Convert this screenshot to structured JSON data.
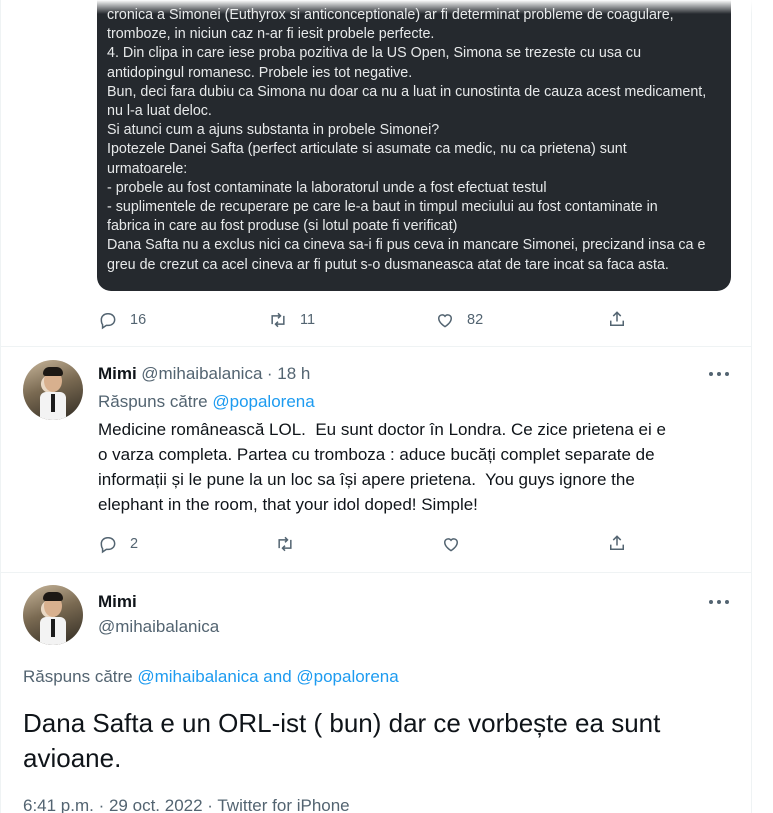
{
  "note_card": {
    "lines": [
      "cronica a Simonei (Euthyrox si anticonceptionale) ar fi determinat probleme de coagulare,",
      "tromboze, in niciun caz n-ar fi iesit probele perfecte.",
      "4. Din clipa in care iese proba pozitiva de la US Open, Simona se trezeste cu usa cu",
      "antidopingul romanesc. Probele ies tot negative.",
      "Bun, deci fara dubiu ca Simona nu doar ca nu a luat in cunostinta de cauza acest medicament,",
      "nu l-a luat deloc.",
      "Si atunci cum a ajuns substanta in probele Simonei?",
      "Ipotezele Danei Safta (perfect articulate si asumate ca medic, nu ca prietena) sunt",
      "urmatoarele:",
      "- probele au fost contaminate la laboratorul unde a fost efectuat testul",
      "- suplimentele de recuperare pe care le-a baut in timpul meciului au fost contaminate in",
      "fabrica in care au fost produse (si lotul poate fi verificat)",
      "Dana Safta nu a exclus nici ca cineva sa-i fi pus ceva in mancare Simonei, precizand insa ca e",
      "greu de crezut ca acel cineva ar fi putut s-o dusmaneasca atat de tare incat sa faca asta."
    ]
  },
  "first_actions": {
    "replies": "16",
    "retweets": "11",
    "likes": "82"
  },
  "reply_tweet": {
    "name": "Mimi",
    "handle": "@mihaibalanica",
    "time": "· 18 h",
    "reply_prefix": "Răspuns către",
    "reply_mention": "@popalorena",
    "text": "Medicine românească LOL.  Eu sunt doctor în Londra. Ce zice prietena ei e\no varza completa. Partea cu tromboza : aduce bucăți complet separate de\ninformații și le pune la un loc sa își apere prietena.  You guys ignore the\nelephant in the room, that your idol doped! Simple!",
    "replies": "2"
  },
  "main_tweet": {
    "name": "Mimi",
    "handle": "@mihaibalanica",
    "reply_prefix": "Răspuns către",
    "reply_mentions": "@mihaibalanica and @popalorena",
    "text": "Dana Safta e un ORL-ist ( bun) dar ce vorbește ea sunt\navioane.",
    "meta": "6:41 p.m. · 29 oct. 2022 · Twitter for iPhone"
  },
  "colors": {
    "accent": "#1d9bf0",
    "muted": "#536471",
    "card_bg": "#25292e"
  }
}
